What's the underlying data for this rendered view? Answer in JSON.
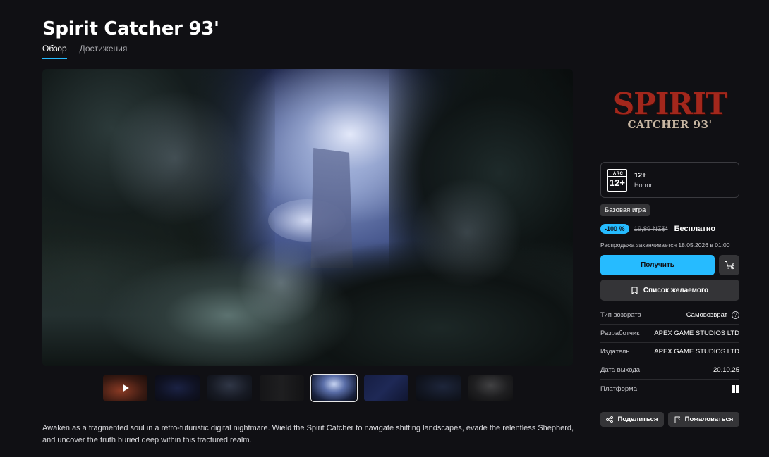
{
  "game": {
    "title": "Spirit Catcher 93'",
    "description": "Awaken as a fragmented soul in a retro-futuristic digital nightmare. Wield the Spirit Catcher to navigate shifting landscapes, evade the relentless Shepherd, and uncover the truth buried deep within this fractured realm."
  },
  "tabs": [
    {
      "label": "Обзор",
      "active": true
    },
    {
      "label": "Достижения",
      "active": false
    }
  ],
  "media": {
    "thumbnail_count": 8,
    "active_thumbnail": 5,
    "first_is_video": true
  },
  "logo": {
    "top": "SPIRIT",
    "bottom": "CATCHER 93'"
  },
  "rating": {
    "iarc_label": "IARC",
    "iarc_age": "12+",
    "age": "12+",
    "genre": "Horror"
  },
  "purchase": {
    "edition_badge": "Базовая игра",
    "discount": "-100 %",
    "old_price": "19,89 NZ$*",
    "new_price": "Бесплатно",
    "sale_end": "Распродажа заканчивается 18.05.2026 в 01:00",
    "get_label": "Получить",
    "wishlist_label": "Список желаемого",
    "accent_color": "#26bbff"
  },
  "info": {
    "refund_label": "Тип возврата",
    "refund_value": "Самовозврат",
    "developer_label": "Разработчик",
    "developer_value": "APEX GAME STUDIOS LTD",
    "publisher_label": "Издатель",
    "publisher_value": "APEX GAME STUDIOS LTD",
    "release_label": "Дата выхода",
    "release_value": "20.10.25",
    "platform_label": "Платформа",
    "platform_icon": "windows-icon"
  },
  "actions": {
    "share_label": "Поделиться",
    "report_label": "Пожаловаться"
  }
}
